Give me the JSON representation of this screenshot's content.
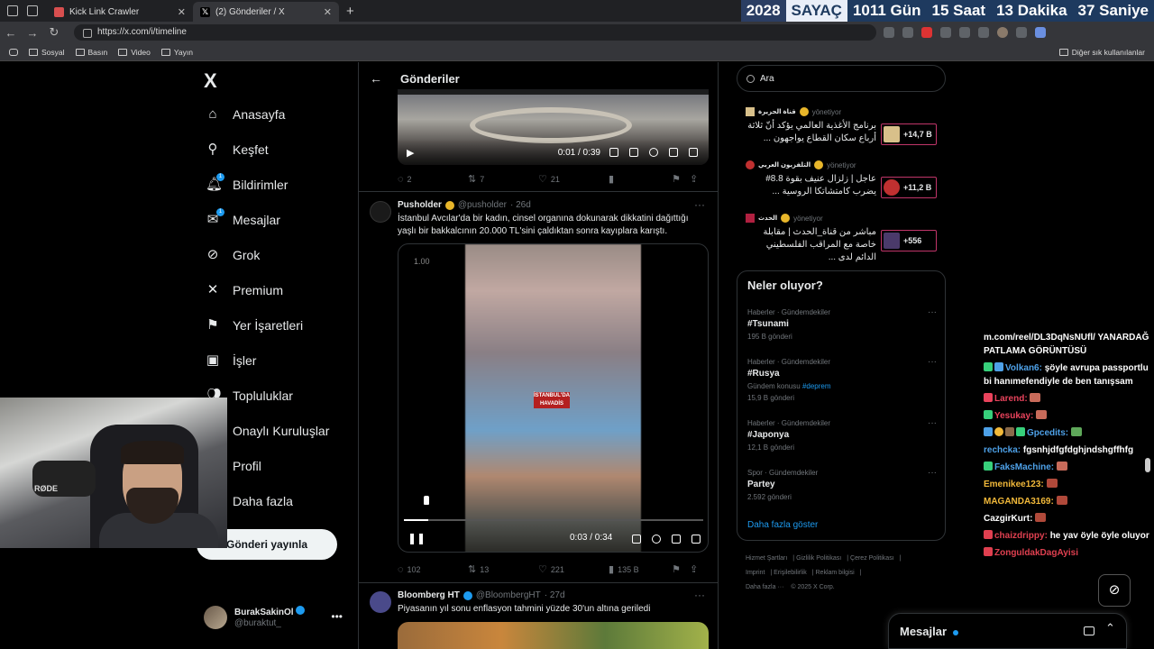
{
  "browser": {
    "tabs": [
      {
        "title": "Kick Link Crawler",
        "favicon_color": "#d84f4f",
        "active": false
      },
      {
        "title": "(2) Gönderiler / X",
        "favicon_color": "#ffffff",
        "active": true
      }
    ],
    "new_tab": "+",
    "url": "https://x.com/i/timeline",
    "bookmarks": [
      "Sosyal",
      "Basın",
      "Video",
      "Yayın"
    ],
    "other_bookmarks": "Diğer sık kullanılanlar"
  },
  "counter": {
    "year": "2028",
    "label": "SAYAÇ",
    "days": "1011 Gün",
    "hours": "15 Saat",
    "minutes": "13 Dakika",
    "seconds": "37 Saniye"
  },
  "nav": {
    "logo": "X",
    "items": [
      {
        "label": "Anasayfa",
        "icon": "home-icon",
        "glyph": "⌂"
      },
      {
        "label": "Keşfet",
        "icon": "search-icon",
        "glyph": "⚲"
      },
      {
        "label": "Bildirimler",
        "icon": "bell-icon",
        "glyph": "🔔︎",
        "badge": "1"
      },
      {
        "label": "Mesajlar",
        "icon": "mail-icon",
        "glyph": "✉",
        "badge": "1"
      },
      {
        "label": "Grok",
        "icon": "grok-icon",
        "glyph": "⊘"
      },
      {
        "label": "Premium",
        "icon": "x-premium-icon",
        "glyph": "✕"
      },
      {
        "label": "Yer İşaretleri",
        "icon": "bookmark-icon",
        "glyph": "⚑"
      },
      {
        "label": "İşler",
        "icon": "briefcase-icon",
        "glyph": "▣"
      },
      {
        "label": "Topluluklar",
        "icon": "community-icon",
        "glyph": "👥︎"
      },
      {
        "label": "Onaylı Kuruluşlar",
        "icon": "verified-org-icon",
        "glyph": "⚡"
      },
      {
        "label": "Profil",
        "icon": "profile-icon",
        "glyph": "☺"
      },
      {
        "label": "Daha fazla",
        "icon": "more-icon",
        "glyph": "⋯"
      }
    ],
    "post_button": "Gönderi yayınla",
    "profile": {
      "name": "BurakSakinOl",
      "handle": "@buraktut_"
    }
  },
  "timeline": {
    "title": "Gönderiler",
    "video1": {
      "time": "0:01 / 0:39"
    },
    "tweet1_actions": {
      "replies": "2",
      "reposts": "7",
      "likes": "21",
      "views": ""
    },
    "tweet2": {
      "name": "Pusholder",
      "handle": "@pusholder",
      "age": "· 26d",
      "text": "İstanbul Avcılar'da bir kadın, cinsel organına dokunarak dikkatini dağıttığı yaşlı bir bakkalcının 20.000 TL'sini çaldıktan sonra kayıplara karıştı.",
      "video": {
        "speed": "1.00",
        "time": "0:03 / 0:34",
        "logo": "İSTANBUL'DA HAVADİS",
        "progress": 0.08
      },
      "actions": {
        "replies": "102",
        "reposts": "13",
        "likes": "221",
        "views": "135 B"
      }
    },
    "tweet3": {
      "name": "Bloomberg HT",
      "handle": "@BloombergHT",
      "age": "· 27d",
      "text": "Piyasanın yıl sonu enflasyon tahmini yüzde 30'un altına geriledi"
    }
  },
  "search": {
    "placeholder": "Ara"
  },
  "ads": [
    {
      "name": "قناة الجزيرة",
      "label": "yönetiyor",
      "text": "برنامج الأغذية العالمي يؤكد أنّ ثلاثة أرباع سكان القطاع يواجهون ...",
      "stat": "+14,7 B"
    },
    {
      "name": "التلفزيون العربي",
      "label": "yönetiyor",
      "text": "عاجل | زلزال عنيف بقوة 8.8# يضرب كامتشاتكا الروسية ...",
      "stat": "+11,2 B"
    },
    {
      "name": "الحدث",
      "label": "yönetiyor",
      "text": "مباشر من قناة_الحدث | مقابلة خاصة مع المراقب الفلسطيني الدائم لدى ...",
      "stat": "+556"
    }
  ],
  "trends": {
    "title": "Neler oluyor?",
    "items": [
      {
        "category": "Haberler · Gündemdekiler",
        "name": "#Tsunami",
        "count": "195 B gönderi",
        "extra": ""
      },
      {
        "category": "Haberler · Gündemdekiler",
        "name": "#Rusya",
        "count": "15,9 B gönderi",
        "extra": "Gündem konusu",
        "extra_tag": "#deprem"
      },
      {
        "category": "Haberler · Gündemdekiler",
        "name": "#Japonya",
        "count": "12,1 B gönderi",
        "extra": ""
      },
      {
        "category": "Spor · Gündemdekiler",
        "name": "Partey",
        "count": "2.592 gönderi",
        "extra": ""
      }
    ],
    "show_more": "Daha fazla göster"
  },
  "footer": {
    "links": [
      "Hizmet Şartları",
      "Gizlilik Politikası",
      "Çerez Politikası",
      "Imprint",
      "Erişilebilirlik",
      "Reklam bilgisi",
      "Daha fazla ···",
      "© 2025 X Corp."
    ]
  },
  "chat": {
    "lines": [
      {
        "user": "",
        "text": "m.com/reel/DL3DqNsNUfl/ YANARDAĞ PATLAMA GÖRÜNTÜSÜ",
        "color": "#ffffff"
      },
      {
        "user": "Volkan6:",
        "text": "şöyle avrupa passportlu bi hanımefendiyle de ben tanışsam",
        "color": "#4ea1e8"
      },
      {
        "user": "Larend:",
        "text": "",
        "color": "#e9435c"
      },
      {
        "user": "Yesukay:",
        "text": "",
        "color": "#e9435c"
      },
      {
        "user": "Gpcedits:",
        "text": "",
        "color": "#4ea1e8"
      },
      {
        "user": "rechcka:",
        "text": "fgsnhjdfgfdghjndshgffhfg",
        "color": "#4ea1e8"
      },
      {
        "user": "FaksMachine:",
        "text": "",
        "color": "#4ea1e8"
      },
      {
        "user": "Emenikee123:",
        "text": "",
        "color": "#f2b93a"
      },
      {
        "user": "MAGANDA3169:",
        "text": "",
        "color": "#f2b93a"
      },
      {
        "user": "CazgirKurt:",
        "text": "",
        "color": "#ffffff"
      },
      {
        "user": "chaizdrippy:",
        "text": "he yav öyle öyle oluyor",
        "color": "#e04050"
      },
      {
        "user": "ZonguldakDagAyisi",
        "text": "",
        "color": "#e04050"
      }
    ]
  },
  "messages_dock": {
    "title": "Mesajlar"
  }
}
